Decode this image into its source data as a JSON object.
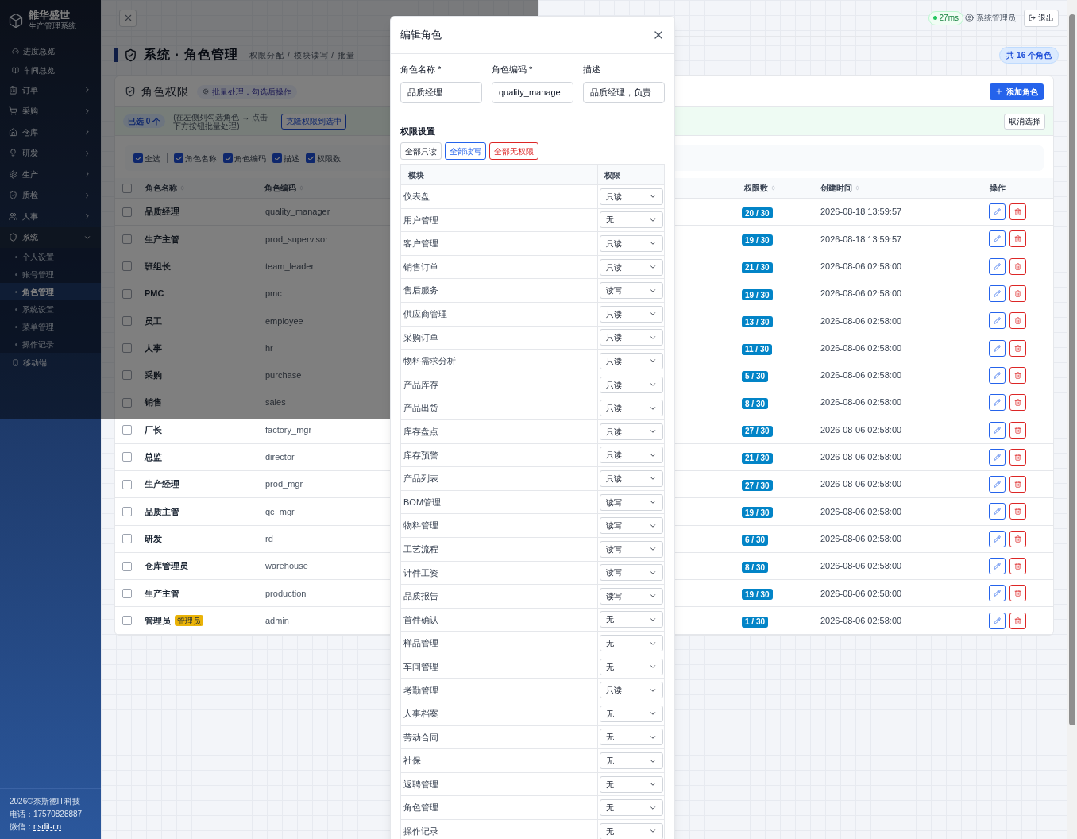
{
  "sidebar": {
    "brand": {
      "name": "雒华盛世",
      "subtitle": "生产管理系统"
    },
    "items": [
      {
        "kind": "link",
        "label": "进度总览"
      },
      {
        "kind": "link",
        "label": "车间总览"
      },
      {
        "kind": "group",
        "label": "订单",
        "expanded": false
      },
      {
        "kind": "group",
        "label": "采购",
        "expanded": false
      },
      {
        "kind": "group",
        "label": "仓库",
        "expanded": false
      },
      {
        "kind": "group",
        "label": "研发",
        "expanded": false
      },
      {
        "kind": "group",
        "label": "生产",
        "expanded": false
      },
      {
        "kind": "group",
        "label": "质检",
        "expanded": false
      },
      {
        "kind": "group",
        "label": "人事",
        "expanded": false
      },
      {
        "kind": "group",
        "label": "系统",
        "expanded": true,
        "children": [
          {
            "label": "个人设置",
            "selected": false
          },
          {
            "label": "账号管理",
            "selected": false
          },
          {
            "label": "角色管理",
            "selected": true
          },
          {
            "label": "系统设置",
            "selected": false
          },
          {
            "label": "菜单管理",
            "selected": false
          },
          {
            "label": "操作记录",
            "selected": false
          }
        ]
      },
      {
        "kind": "link",
        "label": "移动端"
      }
    ],
    "footer": {
      "copyright": "2026©奈斯德IT科技",
      "phone": "电话：17570828887",
      "wechat_label": "微信：",
      "wechat": "nsdit-cn"
    }
  },
  "header": {
    "latency": "27ms",
    "user": "系统管理员",
    "logout": "退出"
  },
  "page": {
    "title": "系统 · 角色管理",
    "breadcrumb": "权限分配 / 模块读写 / 批量",
    "total": "共 16 个角色"
  },
  "card": {
    "title": "角色权限",
    "batch_hint": "批量处理：勾选后操作",
    "add_button": "添加角色",
    "selection": {
      "count": "已选 0 个",
      "hint": "(在左侧列勾选角色 → 点击下方按钮批量处理)",
      "clone_button": "克隆权限到选中",
      "cancel_button": "取消选择"
    },
    "column_toggles": [
      {
        "label": "全选",
        "checked": true
      },
      {
        "label": "角色名称",
        "checked": true
      },
      {
        "label": "角色编码",
        "checked": true
      },
      {
        "label": "描述",
        "checked": true
      },
      {
        "label": "权限数",
        "checked": true
      }
    ]
  },
  "table": {
    "select_all_checked": false,
    "columns": [
      {
        "label": "角色名称",
        "sortable": true
      },
      {
        "label": "角色编码",
        "sortable": true
      },
      {
        "label": "权限数",
        "sortable": true
      },
      {
        "label": "创建时间",
        "sortable": true
      },
      {
        "label": "操作",
        "sortable": false
      }
    ],
    "rows": [
      {
        "name": "品质经理",
        "code": "quality_manager",
        "count": "20 / 30",
        "created": "2026-08-18 13:59:57",
        "checked": false
      },
      {
        "name": "生产主管",
        "code": "prod_supervisor",
        "count": "19 / 30",
        "created": "2026-08-18 13:59:57",
        "checked": false
      },
      {
        "name": "班组长",
        "code": "team_leader",
        "count": "21 / 30",
        "created": "2026-08-06 02:58:00",
        "checked": false
      },
      {
        "name": "PMC",
        "code": "pmc",
        "count": "19 / 30",
        "created": "2026-08-06 02:58:00",
        "checked": false
      },
      {
        "name": "员工",
        "code": "employee",
        "count": "13 / 30",
        "created": "2026-08-06 02:58:00",
        "checked": false
      },
      {
        "name": "人事",
        "code": "hr",
        "count": "11 / 30",
        "created": "2026-08-06 02:58:00",
        "checked": false
      },
      {
        "name": "采购",
        "code": "purchase",
        "count": "5 / 30",
        "created": "2026-08-06 02:58:00",
        "checked": false
      },
      {
        "name": "销售",
        "code": "sales",
        "count": "8 / 30",
        "created": "2026-08-06 02:58:00",
        "checked": false
      },
      {
        "name": "厂长",
        "code": "factory_mgr",
        "count": "27 / 30",
        "created": "2026-08-06 02:58:00",
        "checked": false
      },
      {
        "name": "总监",
        "code": "director",
        "count": "21 / 30",
        "created": "2026-08-06 02:58:00",
        "checked": false
      },
      {
        "name": "生产经理",
        "code": "prod_mgr",
        "count": "27 / 30",
        "created": "2026-08-06 02:58:00",
        "checked": false
      },
      {
        "name": "品质主管",
        "code": "qc_mgr",
        "count": "19 / 30",
        "created": "2026-08-06 02:58:00",
        "checked": false
      },
      {
        "name": "研发",
        "code": "rd",
        "count": "6 / 30",
        "created": "2026-08-06 02:58:00",
        "checked": false
      },
      {
        "name": "仓库管理员",
        "code": "warehouse",
        "count": "8 / 30",
        "created": "2026-08-06 02:58:00",
        "checked": false
      },
      {
        "name": "生产主管",
        "code": "production",
        "count": "19 / 30",
        "created": "2026-08-06 02:58:00",
        "checked": false
      },
      {
        "name": "管理员",
        "badge": "管理员",
        "code": "admin",
        "count": "1 / 30",
        "created": "2026-08-06 02:58:00",
        "checked": false
      }
    ]
  },
  "dialog": {
    "title": "编辑角色",
    "fields": [
      {
        "label": "角色名称 *",
        "value": "品质经理"
      },
      {
        "label": "角色编码 *",
        "value": "quality_manage"
      },
      {
        "label": "描述",
        "value": "品质经理，负责"
      }
    ],
    "section": "权限设置",
    "presets": [
      {
        "label": "全部只读",
        "kind": "default"
      },
      {
        "label": "全部读写",
        "kind": "primary"
      },
      {
        "label": "全部无权限",
        "kind": "danger"
      }
    ],
    "columns": [
      "模块",
      "权限"
    ],
    "permissions": [
      {
        "module": "仪表盘",
        "access": "只读"
      },
      {
        "module": "用户管理",
        "access": "无"
      },
      {
        "module": "客户管理",
        "access": "只读"
      },
      {
        "module": "销售订单",
        "access": "只读"
      },
      {
        "module": "售后服务",
        "access": "读写"
      },
      {
        "module": "供应商管理",
        "access": "只读"
      },
      {
        "module": "采购订单",
        "access": "只读"
      },
      {
        "module": "物料需求分析",
        "access": "只读"
      },
      {
        "module": "产品库存",
        "access": "只读"
      },
      {
        "module": "产品出货",
        "access": "只读"
      },
      {
        "module": "库存盘点",
        "access": "只读"
      },
      {
        "module": "库存预警",
        "access": "只读"
      },
      {
        "module": "产品列表",
        "access": "只读"
      },
      {
        "module": "BOM管理",
        "access": "读写"
      },
      {
        "module": "物料管理",
        "access": "读写"
      },
      {
        "module": "工艺流程",
        "access": "读写"
      },
      {
        "module": "计件工资",
        "access": "读写"
      },
      {
        "module": "品质报告",
        "access": "读写"
      },
      {
        "module": "首件确认",
        "access": "无"
      },
      {
        "module": "样品管理",
        "access": "无"
      },
      {
        "module": "车间管理",
        "access": "无"
      },
      {
        "module": "考勤管理",
        "access": "只读"
      },
      {
        "module": "人事档案",
        "access": "无"
      },
      {
        "module": "劳动合同",
        "access": "无"
      },
      {
        "module": "社保",
        "access": "无"
      },
      {
        "module": "返聘管理",
        "access": "无"
      },
      {
        "module": "角色管理",
        "access": "无"
      },
      {
        "module": "操作记录",
        "access": "无"
      }
    ]
  }
}
